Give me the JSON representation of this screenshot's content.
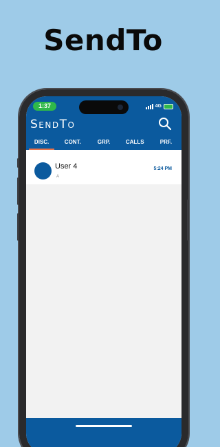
{
  "promo": {
    "title": "SendTo"
  },
  "status_bar": {
    "time": "1:37",
    "network": "4G"
  },
  "app": {
    "title": "SendTo"
  },
  "tabs": [
    {
      "label": "DISC.",
      "active": true
    },
    {
      "label": "CONT.",
      "active": false
    },
    {
      "label": "GRP.",
      "active": false
    },
    {
      "label": "CALLS",
      "active": false
    },
    {
      "label": "PRF.",
      "active": false
    }
  ],
  "conversations": [
    {
      "name": "User 4",
      "last_message": "A",
      "time": "5:24 PM"
    }
  ],
  "colors": {
    "background": "#9ecbe8",
    "primary": "#0b5a9e",
    "active_tab_indicator": "#e8734a",
    "time_pill": "#2fb84a"
  },
  "icons": {
    "search": "search-icon"
  }
}
